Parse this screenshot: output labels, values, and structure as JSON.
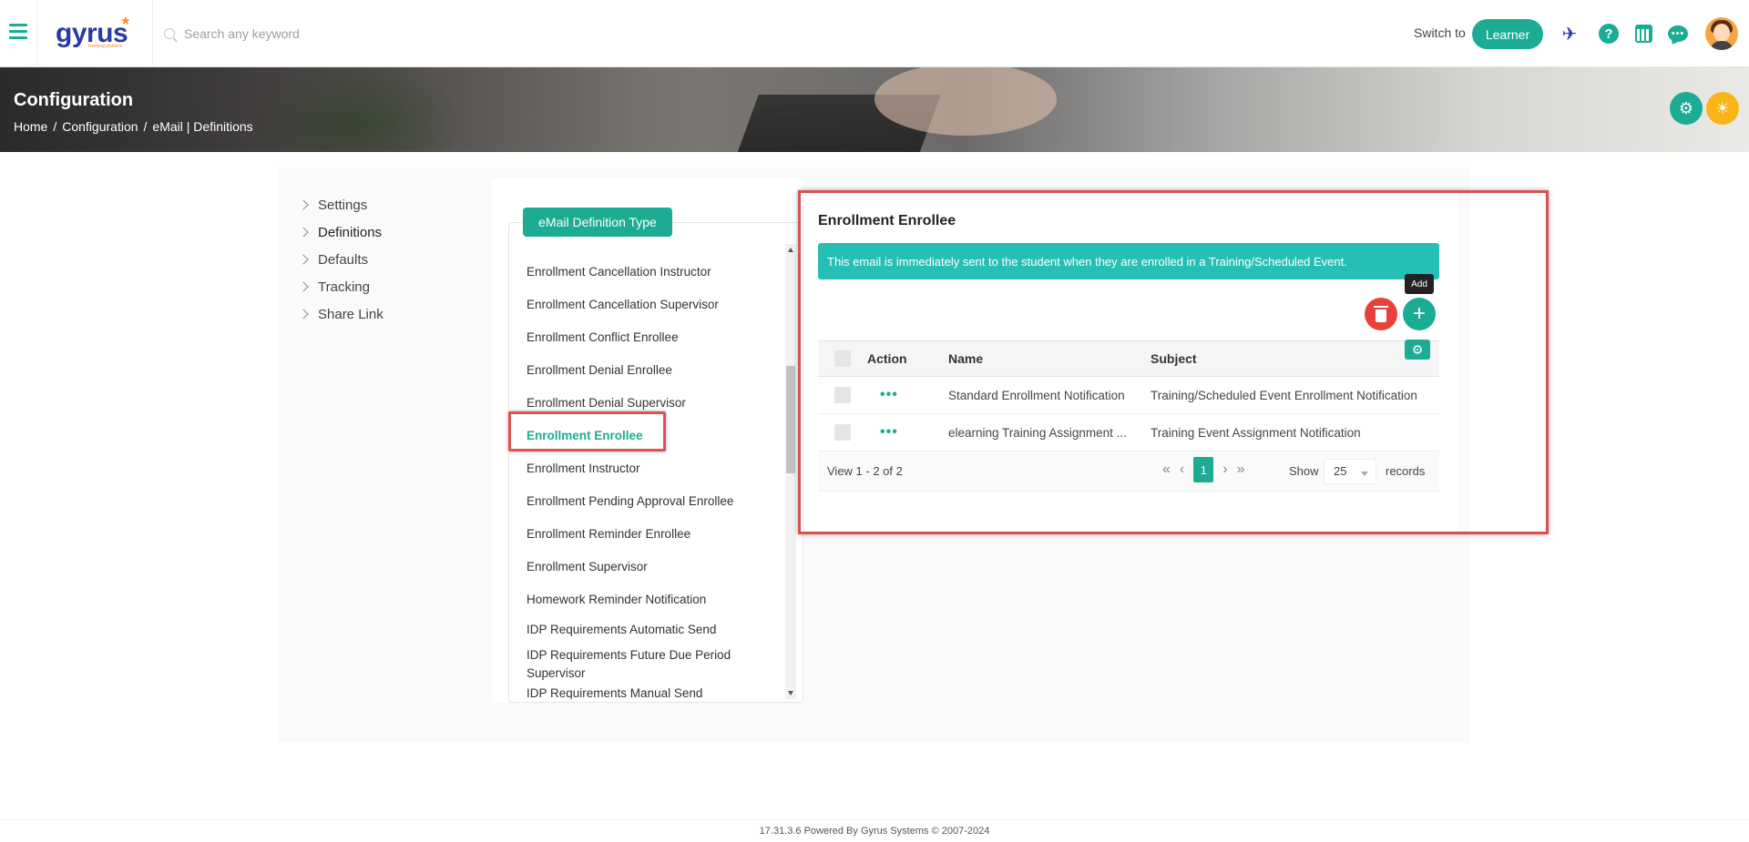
{
  "header": {
    "logo_text": "gyrus",
    "logo_sub": "learning platform",
    "search_placeholder": "Search any keyword",
    "switch_to_label": "Switch to",
    "learner_button": "Learner",
    "help_glyph": "?",
    "chat_glyph": "•••"
  },
  "banner": {
    "title": "Configuration",
    "breadcrumb": [
      "Home",
      "Configuration",
      "eMail | Definitions"
    ],
    "breadcrumb_sep": "/"
  },
  "left_menu": {
    "items": [
      "Settings",
      "Definitions",
      "Defaults",
      "Tracking",
      "Share Link"
    ]
  },
  "type_panel": {
    "title": "eMail Definition Type",
    "items": [
      "Enrollment Cancellation Instructor",
      "Enrollment Cancellation Supervisor",
      "Enrollment Conflict Enrollee",
      "Enrollment Denial Enrollee",
      "Enrollment Denial Supervisor",
      "Enrollment Enrollee",
      "Enrollment Instructor",
      "Enrollment Pending Approval Enrollee",
      "Enrollment Reminder Enrollee",
      "Enrollment Supervisor",
      "Homework Reminder Notification",
      "IDP Requirements Automatic Send",
      "IDP Requirements Future Due Period Supervisor",
      "IDP Requirements Manual Send"
    ],
    "selected": "Enrollment Enrollee"
  },
  "detail": {
    "title": "Enrollment Enrollee",
    "info": "This email is immediately sent to the student when they are enrolled in a Training/Scheduled Event.",
    "add_tooltip": "Add",
    "add_glyph": "+",
    "columns": {
      "action": "Action",
      "name": "Name",
      "subject": "Subject"
    },
    "rows": [
      {
        "action": "•••",
        "name": "Standard Enrollment Notification",
        "subject": "Training/Scheduled Event Enrollment Notification"
      },
      {
        "action": "•••",
        "name": "elearning Training Assignment ...",
        "subject": "Training  Event Assignment Notification"
      }
    ],
    "pager": {
      "view_text": "View 1 - 2 of 2",
      "first": "«",
      "prev": "‹",
      "current_page": "1",
      "next": "›",
      "last": "»",
      "show_label": "Show",
      "page_size": "25",
      "records_label": "records"
    }
  },
  "footer": {
    "text": "17.31.3.6 Powered By Gyrus Systems © 2007-2024"
  },
  "colors": {
    "accent": "#1cac93",
    "info": "#26bfb5",
    "danger": "#e8413b",
    "highlight_outline": "#d9534f",
    "bulb": "#f9b418"
  }
}
